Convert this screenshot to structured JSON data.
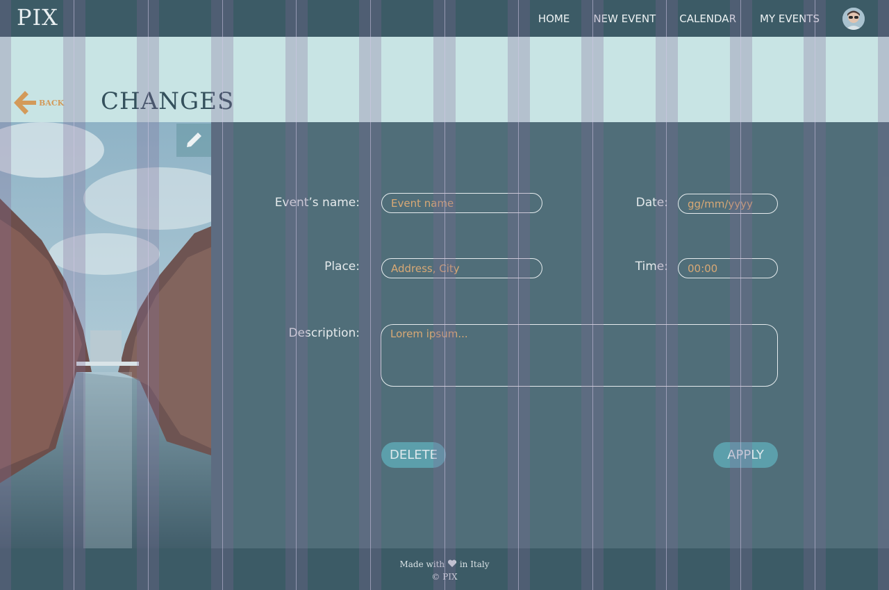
{
  "header": {
    "logo": "PIX",
    "nav": [
      "HOME",
      "NEW EVENT",
      "CALENDAR",
      "MY EVENTS"
    ]
  },
  "title_bar": {
    "back_label": "BACK",
    "title": "CHANGES"
  },
  "form": {
    "name_label": "Event’s name:",
    "name_placeholder": "Event name",
    "date_label": "Date:",
    "date_placeholder": "gg/mm/yyyy",
    "place_label": "Place:",
    "place_placeholder": "Address, City",
    "time_label": "Time:",
    "time_placeholder": "00:00",
    "description_label": "Description:",
    "description_placeholder": "Lorem ipsum..."
  },
  "actions": {
    "delete_label": "DELETE",
    "apply_label": "APPLY"
  },
  "footer": {
    "made_prefix": "Made with",
    "made_suffix": "in Italy",
    "copyright": "© PIX"
  },
  "icons": {
    "back": "arrow-left-icon",
    "edit": "pencil-icon",
    "heart": "heart-icon",
    "avatar": "user-avatar"
  },
  "colors": {
    "header_bg": "#3c5b66",
    "main_bg": "#506e79",
    "band_bg": "#c8e4e4",
    "accent": "#d39a5a",
    "button_bg": "#5c9fab"
  }
}
